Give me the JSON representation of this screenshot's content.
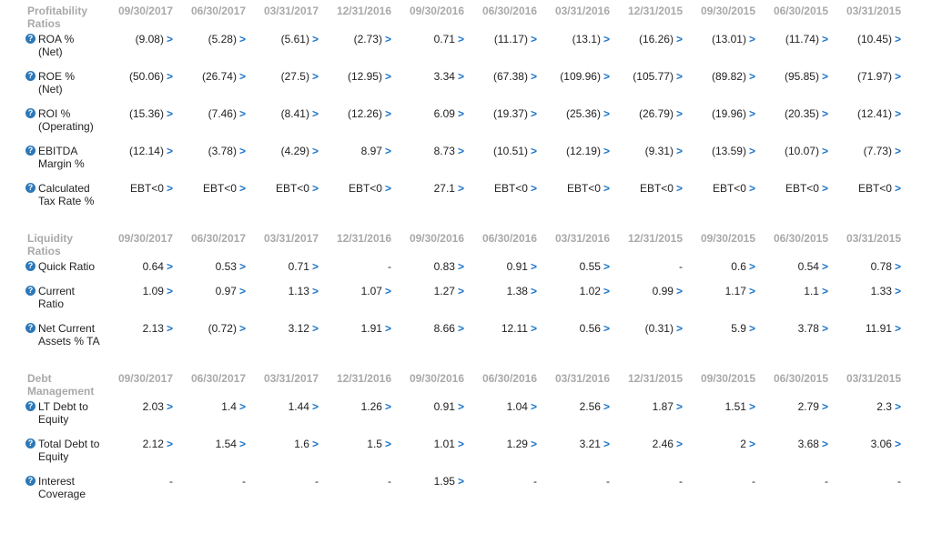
{
  "sections": [
    {
      "title": "Profitability Ratios",
      "dates": [
        "09/30/2017",
        "06/30/2017",
        "03/31/2017",
        "12/31/2016",
        "09/30/2016",
        "06/30/2016",
        "03/31/2016",
        "12/31/2015",
        "09/30/2015",
        "06/30/2015",
        "03/31/2015"
      ],
      "rows": [
        {
          "label": "ROA % (Net)",
          "values": [
            "(9.08)",
            "(5.28)",
            "(5.61)",
            "(2.73)",
            "0.71",
            "(11.17)",
            "(13.1)",
            "(16.26)",
            "(13.01)",
            "(11.74)",
            "(10.45)"
          ]
        },
        {
          "label": "ROE % (Net)",
          "values": [
            "(50.06)",
            "(26.74)",
            "(27.5)",
            "(12.95)",
            "3.34",
            "(67.38)",
            "(109.96)",
            "(105.77)",
            "(89.82)",
            "(95.85)",
            "(71.97)"
          ]
        },
        {
          "label": "ROI % (Operating)",
          "values": [
            "(15.36)",
            "(7.46)",
            "(8.41)",
            "(12.26)",
            "6.09",
            "(19.37)",
            "(25.36)",
            "(26.79)",
            "(19.96)",
            "(20.35)",
            "(12.41)"
          ]
        },
        {
          "label": "EBITDA Margin %",
          "values": [
            "(12.14)",
            "(3.78)",
            "(4.29)",
            "8.97",
            "8.73",
            "(10.51)",
            "(12.19)",
            "(9.31)",
            "(13.59)",
            "(10.07)",
            "(7.73)"
          ]
        },
        {
          "label": "Calculated Tax Rate %",
          "values": [
            "EBT<0",
            "EBT<0",
            "EBT<0",
            "EBT<0",
            "27.1",
            "EBT<0",
            "EBT<0",
            "EBT<0",
            "EBT<0",
            "EBT<0",
            "EBT<0"
          ]
        }
      ]
    },
    {
      "title": "Liquidity Ratios",
      "dates": [
        "09/30/2017",
        "06/30/2017",
        "03/31/2017",
        "12/31/2016",
        "09/30/2016",
        "06/30/2016",
        "03/31/2016",
        "12/31/2015",
        "09/30/2015",
        "06/30/2015",
        "03/31/2015"
      ],
      "rows": [
        {
          "label": "Quick Ratio",
          "values": [
            "0.64",
            "0.53",
            "0.71",
            "-",
            "0.83",
            "0.91",
            "0.55",
            "-",
            "0.6",
            "0.54",
            "0.78"
          ]
        },
        {
          "label": "Current Ratio",
          "values": [
            "1.09",
            "0.97",
            "1.13",
            "1.07",
            "1.27",
            "1.38",
            "1.02",
            "0.99",
            "1.17",
            "1.1",
            "1.33"
          ]
        },
        {
          "label": "Net Current Assets % TA",
          "values": [
            "2.13",
            "(0.72)",
            "3.12",
            "1.91",
            "8.66",
            "12.11",
            "0.56",
            "(0.31)",
            "5.9",
            "3.78",
            "11.91"
          ]
        }
      ]
    },
    {
      "title": "Debt Management",
      "dates": [
        "09/30/2017",
        "06/30/2017",
        "03/31/2017",
        "12/31/2016",
        "09/30/2016",
        "06/30/2016",
        "03/31/2016",
        "12/31/2015",
        "09/30/2015",
        "06/30/2015",
        "03/31/2015"
      ],
      "rows": [
        {
          "label": "LT Debt to Equity",
          "values": [
            "2.03",
            "1.4",
            "1.44",
            "1.26",
            "0.91",
            "1.04",
            "2.56",
            "1.87",
            "1.51",
            "2.79",
            "2.3"
          ]
        },
        {
          "label": "Total Debt to Equity",
          "values": [
            "2.12",
            "1.54",
            "1.6",
            "1.5",
            "1.01",
            "1.29",
            "3.21",
            "2.46",
            "2",
            "3.68",
            "3.06"
          ]
        },
        {
          "label": "Interest Coverage",
          "values": [
            "-",
            "-",
            "-",
            "-",
            "1.95",
            "-",
            "-",
            "-",
            "-",
            "-",
            "-"
          ]
        }
      ]
    }
  ],
  "help_glyph": "?",
  "drill_glyph": ">",
  "colors": {
    "header": "#a9a9a9",
    "accent": "#1a73c7",
    "help": "#2b78b8"
  }
}
